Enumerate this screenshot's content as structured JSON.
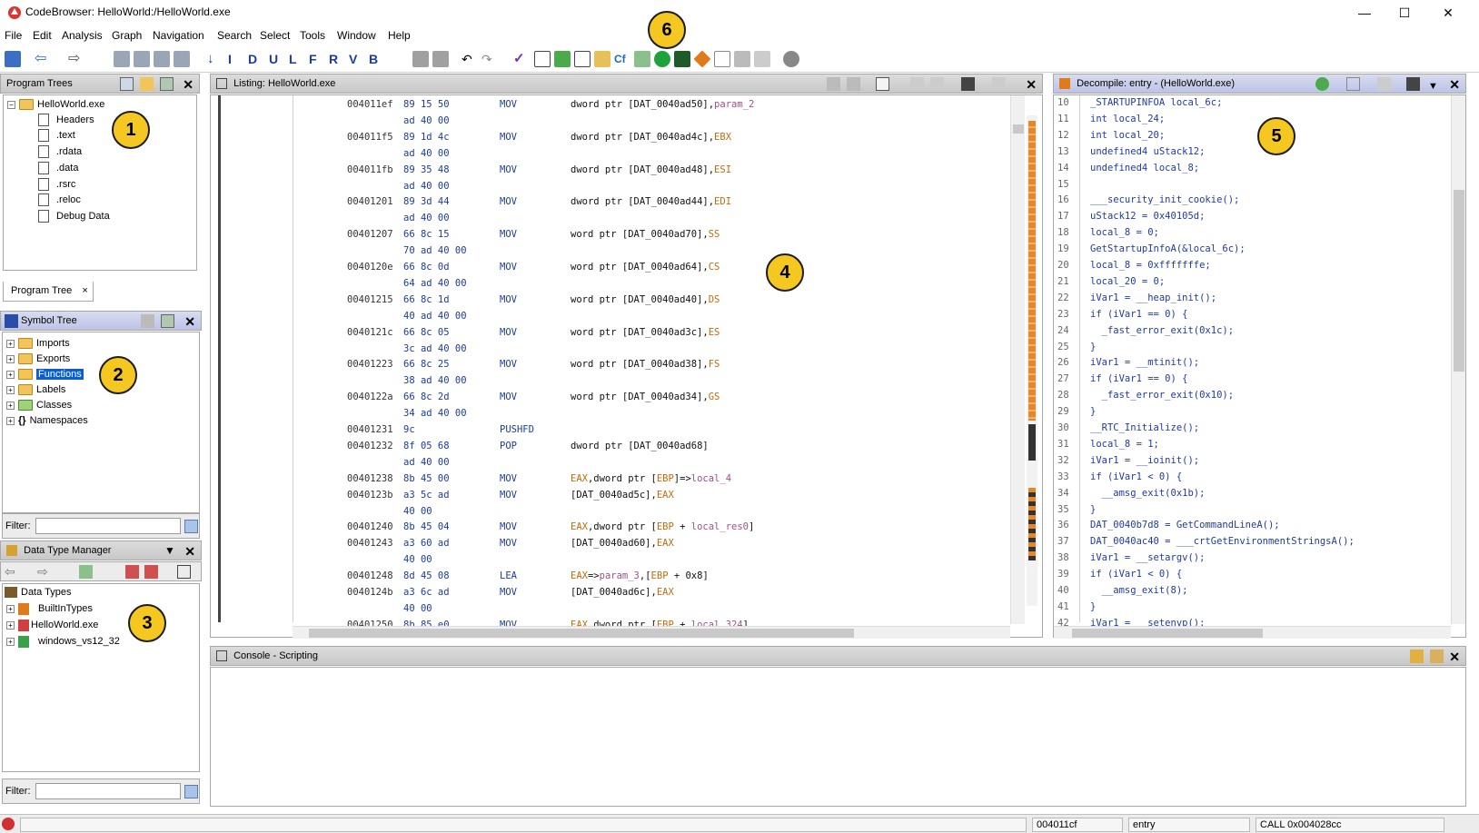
{
  "window": {
    "title": "CodeBrowser: HelloWorld:/HelloWorld.exe",
    "minimize": "—",
    "maximize": "☐",
    "close": "✕"
  },
  "menu": [
    "File",
    "Edit",
    "Analysis",
    "Graph",
    "Navigation",
    "Search",
    "Select",
    "Tools",
    "Window",
    "Help"
  ],
  "badges": [
    "1",
    "2",
    "3",
    "4",
    "5",
    "6"
  ],
  "program_trees": {
    "title": "Program Trees",
    "root": "HelloWorld.exe",
    "items": [
      "Headers",
      ".text",
      ".rdata",
      ".data",
      ".rsrc",
      ".reloc",
      "Debug Data"
    ],
    "tab": "Program Tree",
    "tab_close": "×"
  },
  "symbol_tree": {
    "title": "Symbol Tree",
    "items": [
      "Imports",
      "Exports",
      "Functions",
      "Labels",
      "Classes",
      "Namespaces"
    ],
    "selected": "Functions",
    "filter_label": "Filter:"
  },
  "data_type_manager": {
    "title": "Data Type Manager",
    "root": "Data Types",
    "items": [
      "BuiltInTypes",
      "HelloWorld.exe",
      "windows_vs12_32"
    ],
    "filter_label": "Filter:"
  },
  "listing": {
    "title": "Listing:  HelloWorld.exe",
    "lines": [
      {
        "addr": "004011ef",
        "bytes": "89 15 50",
        "mnem": "MOV",
        "oper": "dword ptr [DAT_0040ad50],param_2"
      },
      {
        "addr": "",
        "bytes": "ad 40 00",
        "mnem": "",
        "oper": ""
      },
      {
        "addr": "004011f5",
        "bytes": "89 1d 4c",
        "mnem": "MOV",
        "oper": "dword ptr [DAT_0040ad4c],EBX"
      },
      {
        "addr": "",
        "bytes": "ad 40 00",
        "mnem": "",
        "oper": ""
      },
      {
        "addr": "004011fb",
        "bytes": "89 35 48",
        "mnem": "MOV",
        "oper": "dword ptr [DAT_0040ad48],ESI"
      },
      {
        "addr": "",
        "bytes": "ad 40 00",
        "mnem": "",
        "oper": ""
      },
      {
        "addr": "00401201",
        "bytes": "89 3d 44",
        "mnem": "MOV",
        "oper": "dword ptr [DAT_0040ad44],EDI"
      },
      {
        "addr": "",
        "bytes": "ad 40 00",
        "mnem": "",
        "oper": ""
      },
      {
        "addr": "00401207",
        "bytes": "66 8c 15",
        "mnem": "MOV",
        "oper": "word ptr [DAT_0040ad70],SS"
      },
      {
        "addr": "",
        "bytes": "70 ad 40 00",
        "mnem": "",
        "oper": ""
      },
      {
        "addr": "0040120e",
        "bytes": "66 8c 0d",
        "mnem": "MOV",
        "oper": "word ptr [DAT_0040ad64],CS"
      },
      {
        "addr": "",
        "bytes": "64 ad 40 00",
        "mnem": "",
        "oper": ""
      },
      {
        "addr": "00401215",
        "bytes": "66 8c 1d",
        "mnem": "MOV",
        "oper": "word ptr [DAT_0040ad40],DS"
      },
      {
        "addr": "",
        "bytes": "40 ad 40 00",
        "mnem": "",
        "oper": ""
      },
      {
        "addr": "0040121c",
        "bytes": "66 8c 05",
        "mnem": "MOV",
        "oper": "word ptr [DAT_0040ad3c],ES"
      },
      {
        "addr": "",
        "bytes": "3c ad 40 00",
        "mnem": "",
        "oper": ""
      },
      {
        "addr": "00401223",
        "bytes": "66 8c 25",
        "mnem": "MOV",
        "oper": "word ptr [DAT_0040ad38],FS"
      },
      {
        "addr": "",
        "bytes": "38 ad 40 00",
        "mnem": "",
        "oper": ""
      },
      {
        "addr": "0040122a",
        "bytes": "66 8c 2d",
        "mnem": "MOV",
        "oper": "word ptr [DAT_0040ad34],GS"
      },
      {
        "addr": "",
        "bytes": "34 ad 40 00",
        "mnem": "",
        "oper": ""
      },
      {
        "addr": "00401231",
        "bytes": "9c",
        "mnem": "PUSHFD",
        "oper": ""
      },
      {
        "addr": "00401232",
        "bytes": "8f 05 68",
        "mnem": "POP",
        "oper": "dword ptr [DAT_0040ad68]"
      },
      {
        "addr": "",
        "bytes": "ad 40 00",
        "mnem": "",
        "oper": ""
      },
      {
        "addr": "00401238",
        "bytes": "8b 45 00",
        "mnem": "MOV",
        "oper": "EAX,dword ptr [EBP]=>local_4"
      },
      {
        "addr": "0040123b",
        "bytes": "a3 5c ad",
        "mnem": "MOV",
        "oper": "[DAT_0040ad5c],EAX"
      },
      {
        "addr": "",
        "bytes": "40 00",
        "mnem": "",
        "oper": ""
      },
      {
        "addr": "00401240",
        "bytes": "8b 45 04",
        "mnem": "MOV",
        "oper": "EAX,dword ptr [EBP + local_res0]"
      },
      {
        "addr": "00401243",
        "bytes": "a3 60 ad",
        "mnem": "MOV",
        "oper": "[DAT_0040ad60],EAX"
      },
      {
        "addr": "",
        "bytes": "40 00",
        "mnem": "",
        "oper": ""
      },
      {
        "addr": "00401248",
        "bytes": "8d 45 08",
        "mnem": "LEA",
        "oper": "EAX=>param_3,[EBP + 0x8]"
      },
      {
        "addr": "0040124b",
        "bytes": "a3 6c ad",
        "mnem": "MOV",
        "oper": "[DAT_0040ad6c],EAX"
      },
      {
        "addr": "",
        "bytes": "40 00",
        "mnem": "",
        "oper": ""
      },
      {
        "addr": "00401250",
        "bytes": "8b 85 e0",
        "mnem": "MOV",
        "oper": "EAX,dword ptr [EBP + local_324]"
      }
    ]
  },
  "decompile": {
    "title": "Decompile: entry -  (HelloWorld.exe)",
    "lines": [
      {
        "n": "10",
        "code": "_STARTUPINFOA local_6c;"
      },
      {
        "n": "11",
        "code": "int local_24;"
      },
      {
        "n": "12",
        "code": "int local_20;"
      },
      {
        "n": "13",
        "code": "undefined4 uStack12;"
      },
      {
        "n": "14",
        "code": "undefined4 local_8;"
      },
      {
        "n": "15",
        "code": ""
      },
      {
        "n": "16",
        "code": "___security_init_cookie();"
      },
      {
        "n": "17",
        "code": "uStack12 = 0x40105d;"
      },
      {
        "n": "18",
        "code": "local_8 = 0;"
      },
      {
        "n": "19",
        "code": "GetStartupInfoA(&local_6c);"
      },
      {
        "n": "20",
        "code": "local_8 = 0xfffffffe;"
      },
      {
        "n": "21",
        "code": "local_20 = 0;"
      },
      {
        "n": "22",
        "code": "iVar1 = __heap_init();"
      },
      {
        "n": "23",
        "code": "if (iVar1 == 0) {"
      },
      {
        "n": "24",
        "code": "  _fast_error_exit(0x1c);"
      },
      {
        "n": "25",
        "code": "}"
      },
      {
        "n": "26",
        "code": "iVar1 = __mtinit();"
      },
      {
        "n": "27",
        "code": "if (iVar1 == 0) {"
      },
      {
        "n": "28",
        "code": "  _fast_error_exit(0x10);"
      },
      {
        "n": "29",
        "code": "}"
      },
      {
        "n": "30",
        "code": "__RTC_Initialize();"
      },
      {
        "n": "31",
        "code": "local_8 = 1;"
      },
      {
        "n": "32",
        "code": "iVar1 = __ioinit();"
      },
      {
        "n": "33",
        "code": "if (iVar1 < 0) {"
      },
      {
        "n": "34",
        "code": "  __amsg_exit(0x1b);"
      },
      {
        "n": "35",
        "code": "}"
      },
      {
        "n": "36",
        "code": "DAT_0040b7d8 = GetCommandLineA();"
      },
      {
        "n": "37",
        "code": "DAT_0040ac40 = ___crtGetEnvironmentStringsA();"
      },
      {
        "n": "38",
        "code": "iVar1 = __setargv();"
      },
      {
        "n": "39",
        "code": "if (iVar1 < 0) {"
      },
      {
        "n": "40",
        "code": "  __amsg_exit(8);"
      },
      {
        "n": "41",
        "code": "}"
      },
      {
        "n": "42",
        "code": "iVar1 = __setenvp();"
      }
    ]
  },
  "console": {
    "title": "Console - Scripting"
  },
  "status": {
    "address": "004011cf",
    "function": "entry",
    "instruction": "CALL 0x004028cc"
  },
  "colors": {
    "accent_badge": "#f4c820",
    "panel_active": "#bcc3e6",
    "selection": "#0a5fd0",
    "code_blue": "#1e3aa8",
    "register_orange": "#c46a0a"
  }
}
